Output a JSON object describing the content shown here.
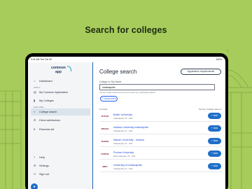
{
  "hero_title": "Search for colleges",
  "status_bar": {
    "left": "9:41 AM Tue Oct 30",
    "right": "100%"
  },
  "sidebar": {
    "logo_line1": "common",
    "logo_line2": "app",
    "items": [
      {
        "label": "Dashboard",
        "icon": "home-icon"
      },
      {
        "label": "My Common Application",
        "icon": "document-icon"
      },
      {
        "label": "My Colleges",
        "icon": "bookmark-icon"
      },
      {
        "label": "College search",
        "icon": "search-icon",
        "active": true
      },
      {
        "label": "Direct admissions",
        "icon": "mail-icon"
      },
      {
        "label": "Financial aid",
        "icon": "dollar-icon"
      },
      {
        "label": "Help",
        "icon": "help-icon"
      },
      {
        "label": "Settings",
        "icon": "gear-icon"
      },
      {
        "label": "Sign out",
        "icon": "sign-out-icon"
      }
    ],
    "section_apply": "APPLY",
    "section_explore": "EXPLORE"
  },
  "main": {
    "title": "College search",
    "requirements_button": "Application requirements",
    "field_label": "College or City Name",
    "field_value": "Indianapolis",
    "hint": "You can include search terms such as a name (e.g. Washington) Boston",
    "more_button": "Show More",
    "results_count": "5 results",
    "sort_label": "Sort by: College name",
    "add_label": "Add",
    "results": [
      {
        "name": "Butler University",
        "location": "Indianapolis, IN - USA",
        "logo": "BUTLER"
      },
      {
        "name": "Indiana University Indianapolis",
        "location": "Indianapolis, IN - USA",
        "logo": "INDIANA"
      },
      {
        "name": "Marian University - Indiana",
        "location": "Indianapolis, IN - USA",
        "logo": "MARIAN"
      },
      {
        "name": "Purdue University",
        "location": "West Lafayette, IN - USA",
        "logo": "PURDUE"
      },
      {
        "name": "University of Indianapolis",
        "location": "Indianapolis, IN - USA",
        "logo": "UINDY"
      }
    ]
  }
}
